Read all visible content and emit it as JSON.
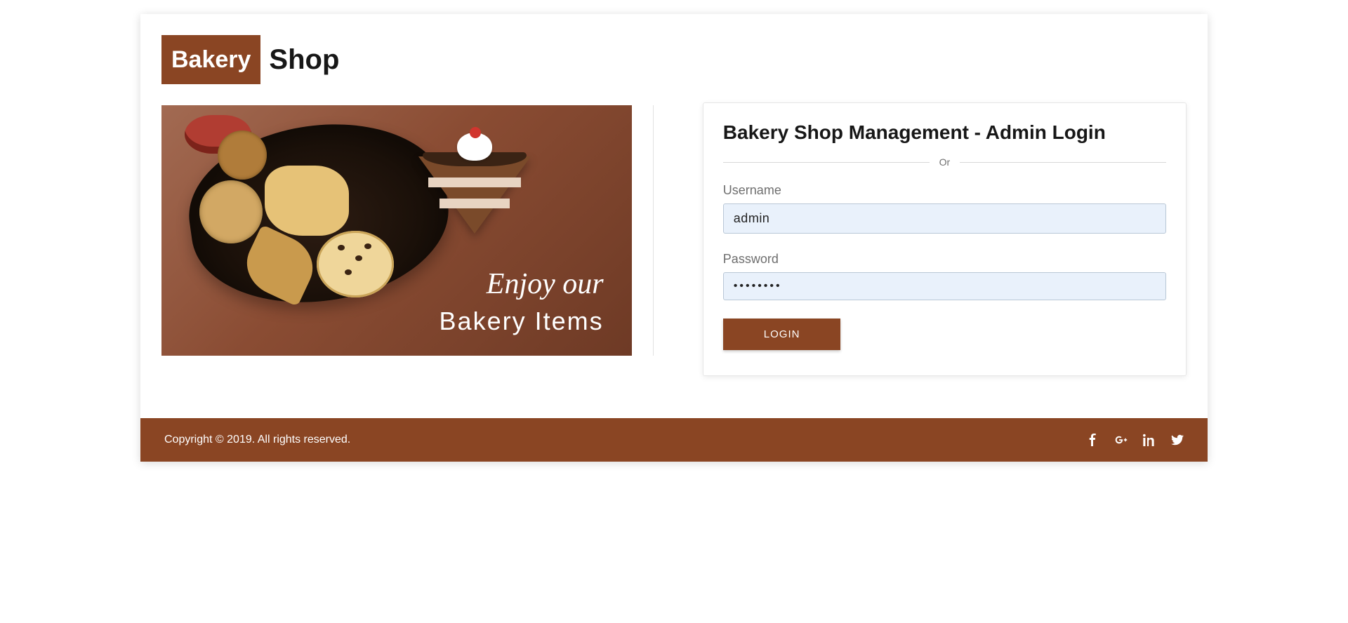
{
  "brand": {
    "badge": "Bakery",
    "text": "Shop",
    "accent_color": "#8a4523"
  },
  "hero": {
    "script_text": "Enjoy our",
    "sub_text": "Bakery Items"
  },
  "login": {
    "heading": "Bakery Shop Management - Admin Login",
    "divider_label": "Or",
    "username_label": "Username",
    "username_value": "admin",
    "password_label": "Password",
    "password_value": "••••••••",
    "button_label": "LOGIN"
  },
  "footer": {
    "copyright": "Copyright © 2019. All rights reserved.",
    "social_icons": [
      "facebook",
      "google-plus",
      "linkedin",
      "twitter"
    ]
  }
}
